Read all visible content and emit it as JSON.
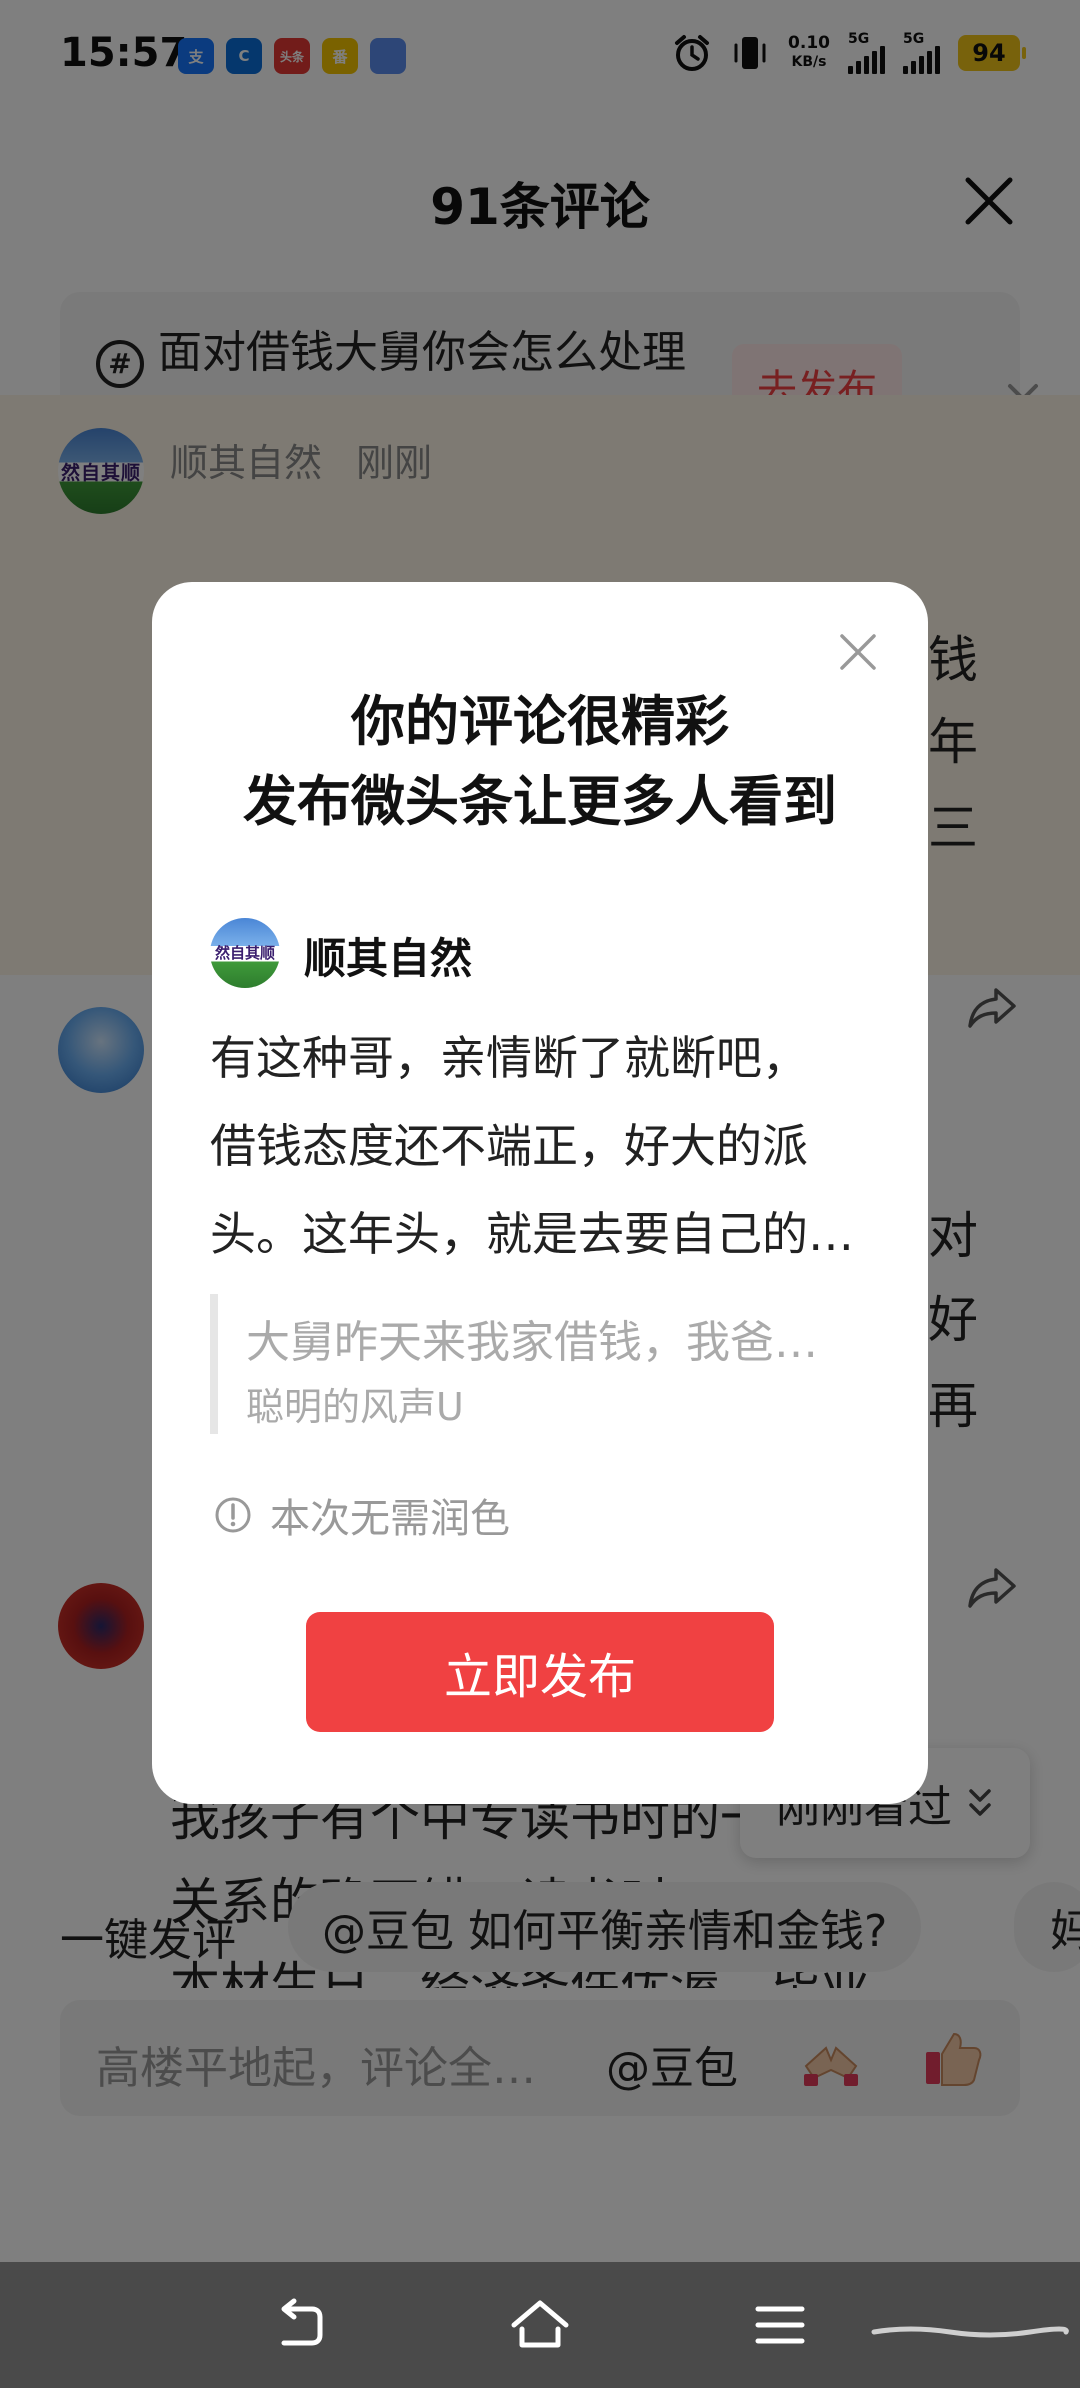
{
  "status_bar": {
    "time": "15:57",
    "net_speed_value": "0.10",
    "net_speed_unit": "KB/s",
    "signal_1_label": "5G",
    "signal_2_label": "5G",
    "battery": "94",
    "app_icons": [
      {
        "name": "alipay-app-icon",
        "glyph": "支",
        "color": "#1677ff"
      },
      {
        "name": "browser-app-icon",
        "glyph": "C",
        "color": "#0a6fdb"
      },
      {
        "name": "toutiao-app-icon",
        "glyph": "头条",
        "color": "#e53935"
      },
      {
        "name": "fanqie-app-icon",
        "glyph": "番",
        "color": "#f4c400"
      },
      {
        "name": "document-app-icon",
        "glyph": "",
        "color": "#5b8def"
      }
    ]
  },
  "sheet": {
    "title": "91条评论",
    "topic": {
      "text": "面对借钱大舅你会怎么处理",
      "publish_label": "去发布"
    },
    "comments": [
      {
        "author": "顺其自然",
        "time": "刚刚",
        "avatar_text": "然自其顺",
        "visible_fragments": [
          "钱",
          "年",
          "三"
        ]
      },
      {
        "visible_fragments": [
          "对",
          "好",
          "再"
        ]
      },
      {
        "lines": [
          "我孩子有个中专读书时的一个朋友，",
          "关系的确不错。读书时，",
          "本材生日，经济条件优渥，毕业"
        ]
      }
    ],
    "recently_viewed_label": "刚刚看过",
    "quick_comment_label": "一键发评",
    "quick_chips": [
      "@豆包 如何平衡亲情和金钱?",
      "妈"
    ],
    "input_placeholder": "高楼平地起，评论全…",
    "input_mention": "@豆包"
  },
  "dialog": {
    "title_line1": "你的评论很精彩",
    "title_line2": "发布微头条让更多人看到",
    "author": "顺其自然",
    "body_lines": [
      "有这种哥，亲情断了就断吧，",
      "借钱态度还不端正，好大的派",
      "头。这年头，就是去要自己的…"
    ],
    "quote_text": "大舅昨天来我家借钱，我爸…",
    "quote_author": "聪明的风声U",
    "tip": "本次无需润色",
    "publish_label": "立即发布"
  },
  "colors": {
    "accent_red": "#f04142",
    "highlight_bg": "#fdf5e6",
    "battery_yellow": "#f0c419"
  }
}
